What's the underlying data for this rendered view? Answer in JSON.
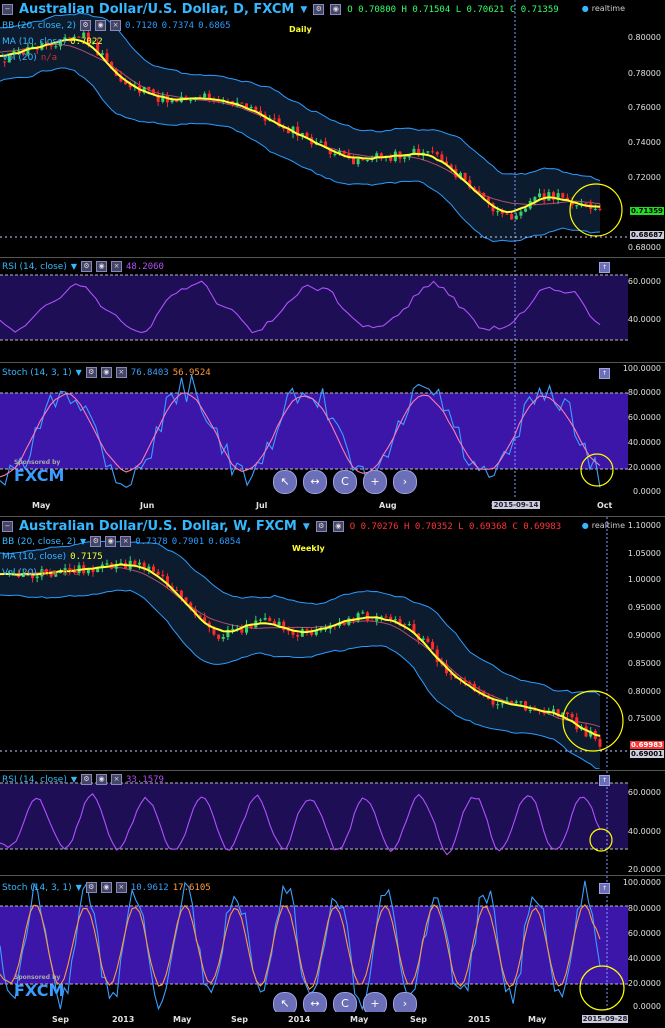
{
  "daily": {
    "symbol": "Australian Dollar/U.S. Dollar, D, FXCM",
    "ohlc": {
      "o_label": "O",
      "o": "0.70800",
      "h_label": "H",
      "h": "0.71504",
      "l_label": "L",
      "l": "0.70621",
      "c_label": "C",
      "c": "0.71359"
    },
    "timeframe_label": "Daily",
    "realtime_label": "realtime",
    "bb_label": "BB (20, close, 2)",
    "bb_values": [
      "0.7120",
      "0.7374",
      "0.6865"
    ],
    "ma_label": "MA (10, close)",
    "ma_value": "0.7022",
    "vol_label": "Vol (20)",
    "vol_value": "n/a",
    "price_ticks": [
      "0.80000",
      "0.78000",
      "0.76000",
      "0.74000",
      "0.72000",
      "0.70000",
      "0.68000"
    ],
    "price_tags": [
      "0.71359",
      "0.68687"
    ],
    "rsi_label": "RSI (14, close)",
    "rsi_value": "48.2060",
    "rsi_ticks": [
      "60.0000",
      "40.0000"
    ],
    "stoch_label": "Stoch (14, 3, 1)",
    "stoch_values": [
      "76.8403",
      "56.9524"
    ],
    "stoch_ticks": [
      "100.0000",
      "80.0000",
      "60.0000",
      "40.0000",
      "20.0000",
      "0.0000"
    ],
    "x_labels": [
      "May",
      "Jun",
      "Jul",
      "Aug",
      "Se",
      "Oct"
    ],
    "date_marker": "2015-09-14",
    "sponsor": "Sponsored by",
    "brand": "FXCM"
  },
  "weekly": {
    "symbol": "Australian Dollar/U.S. Dollar, W, FXCM",
    "ohlc": {
      "o_label": "O",
      "o": "0.70276",
      "h_label": "H",
      "h": "0.70352",
      "l_label": "L",
      "l": "0.69368",
      "c_label": "C",
      "c": "0.69983"
    },
    "timeframe_label": "Weekly",
    "realtime_label": "realtime",
    "bb_label": "BB (20, close, 2)",
    "bb_values": [
      "0.7378",
      "0.7901",
      "0.6854"
    ],
    "ma_label": "MA (10, close)",
    "ma_value": "0.7175",
    "vol_label": "Vol (20)",
    "vol_value": "n/a  n/a",
    "price_ticks": [
      "1.10000",
      "1.05000",
      "1.00000",
      "0.95000",
      "0.90000",
      "0.85000",
      "0.80000",
      "0.75000",
      "0.70000"
    ],
    "price_tags": [
      "0.69983",
      "0.69001"
    ],
    "rsi_label": "RSI (14, close)",
    "rsi_value": "33.1579",
    "rsi_ticks": [
      "60.0000",
      "40.0000",
      "20.0000"
    ],
    "stoch_label": "Stoch (14, 3, 1)",
    "stoch_values": [
      "10.9612",
      "17.6105"
    ],
    "stoch_ticks": [
      "100.0000",
      "80.0000",
      "60.0000",
      "40.0000",
      "20.0000",
      "0.0000"
    ],
    "x_labels": [
      "Sep",
      "2013",
      "May",
      "Sep",
      "2014",
      "May",
      "Sep",
      "2015",
      "May"
    ],
    "date_marker": "2015-09-28",
    "sponsor": "Sponsored by",
    "brand": "FXCM"
  },
  "colors": {
    "up_candle": "#3cd06a",
    "down_candle": "#ff2a2a",
    "bb": "#2b9cff",
    "ma": "#ffff33",
    "rsi": "#b050ff",
    "stoch_k": "#3aa0ff",
    "stoch_d": "#ff9a3c",
    "band": "#3b16a8",
    "highlight": "#ffff00"
  },
  "nav_buttons": [
    "↖",
    "↔",
    "C",
    "+",
    "›"
  ],
  "icons": [
    "chevron-down-icon",
    "settings-icon",
    "visibility-icon",
    "close-icon",
    "minus-icon"
  ]
}
